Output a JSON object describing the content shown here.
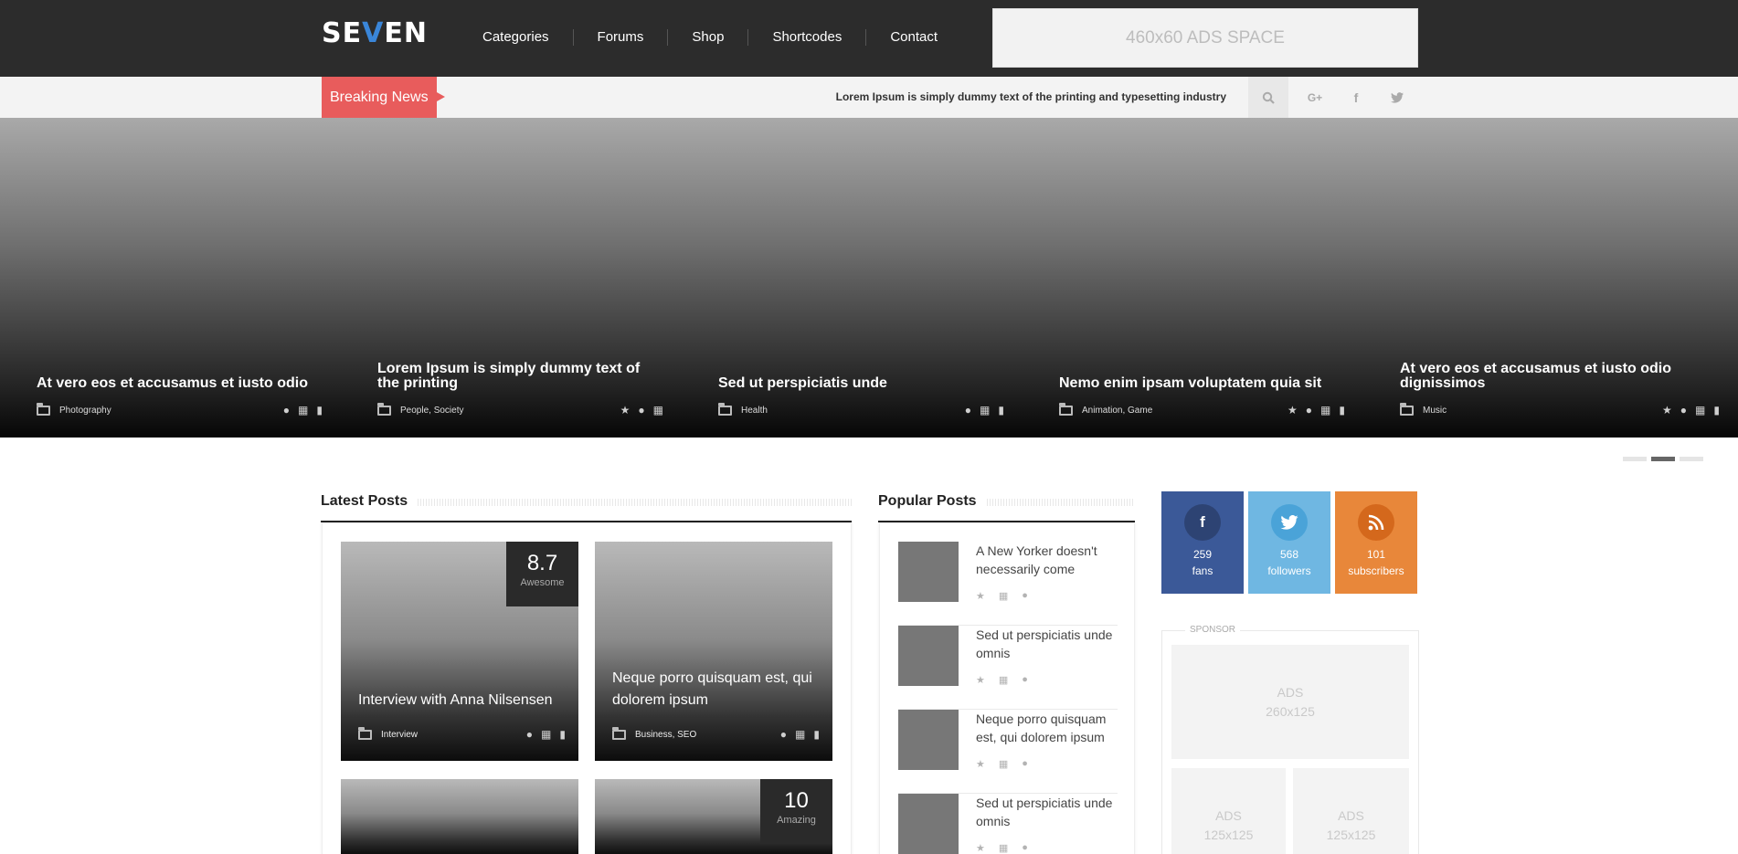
{
  "header": {
    "logo": {
      "part1": "SE",
      "part2": "V",
      "part3": "EN"
    },
    "nav": [
      {
        "label": "Categories"
      },
      {
        "label": "Forums"
      },
      {
        "label": "Shop"
      },
      {
        "label": "Shortcodes"
      },
      {
        "label": "Contact"
      }
    ],
    "ads_label": "460x60 ADS SPACE"
  },
  "newsbar": {
    "breaking_label": "Breaking News",
    "ticker_text": "Lorem Ipsum is simply dummy text of the printing and typesetting industry",
    "icons": [
      "search-icon",
      "google-plus-icon",
      "facebook-icon",
      "twitter-icon"
    ],
    "gplus_glyph": "G+",
    "fb_glyph": "f"
  },
  "hero": {
    "slides": [
      {
        "title": "At vero eos et accusamus et iusto odio",
        "category": "Photography",
        "icons": [
          "user-icon",
          "calendar-icon",
          "comment-icon"
        ]
      },
      {
        "title": "Lorem Ipsum is simply dummy text of the printing",
        "category": "People, Society",
        "icons": [
          "star-icon",
          "user-icon",
          "calendar-icon"
        ]
      },
      {
        "title": "Sed ut perspiciatis unde",
        "category": "Health",
        "icons": [
          "user-icon",
          "calendar-icon",
          "comment-icon"
        ]
      },
      {
        "title": "Nemo enim ipsam voluptatem quia sit",
        "category": "Animation, Game",
        "icons": [
          "star-icon",
          "user-icon",
          "calendar-icon",
          "comment-icon"
        ]
      },
      {
        "title": "At vero eos et accusamus et iusto odio dignissimos",
        "category": "Music",
        "icons": [
          "star-icon",
          "user-icon",
          "calendar-icon",
          "comment-icon"
        ]
      }
    ],
    "active_dot": 1,
    "dot_count": 3
  },
  "latest": {
    "title": "Latest Posts",
    "cards": [
      {
        "title": "Interview with Anna Nilsensen",
        "category": "Interview",
        "score": "8.7",
        "score_label": "Awesome"
      },
      {
        "title": "Neque porro quisquam est, qui dolorem ipsum",
        "category": "Business, SEO",
        "score": "",
        "score_label": ""
      },
      {
        "title": "",
        "category": "",
        "score": "",
        "score_label": ""
      },
      {
        "title": "",
        "category": "",
        "score": "10",
        "score_label": "Amazing"
      }
    ]
  },
  "popular": {
    "title": "Popular Posts",
    "items": [
      {
        "title": "A New Yorker doesn't necessarily come"
      },
      {
        "title": "Sed ut perspiciatis unde omnis"
      },
      {
        "title": "Neque porro quisquam est, qui dolorem ipsum"
      },
      {
        "title": "Sed ut perspiciatis unde omnis"
      }
    ]
  },
  "social": [
    {
      "network": "facebook",
      "glyph": "f",
      "count": "259",
      "label": "fans",
      "color": "#3b5998",
      "circle": "#2d4373"
    },
    {
      "network": "twitter",
      "glyph": "",
      "count": "568",
      "label": "followers",
      "color": "#6fb7e2",
      "circle": "#4aa3d8"
    },
    {
      "network": "rss",
      "glyph": "",
      "count": "101",
      "label": "subscribers",
      "color": "#e8873a",
      "circle": "#d4681c"
    }
  ],
  "sponsor": {
    "label": "SPONSOR",
    "ads": [
      {
        "line1": "ADS",
        "line2": "260x125"
      },
      {
        "line1": "ADS",
        "line2": "125x125"
      },
      {
        "line1": "ADS",
        "line2": "125x125"
      }
    ]
  },
  "colors": {
    "topbar": "#2c2c2c",
    "accent_red": "#e85c5c",
    "newsbar": "#f3f3f3"
  }
}
